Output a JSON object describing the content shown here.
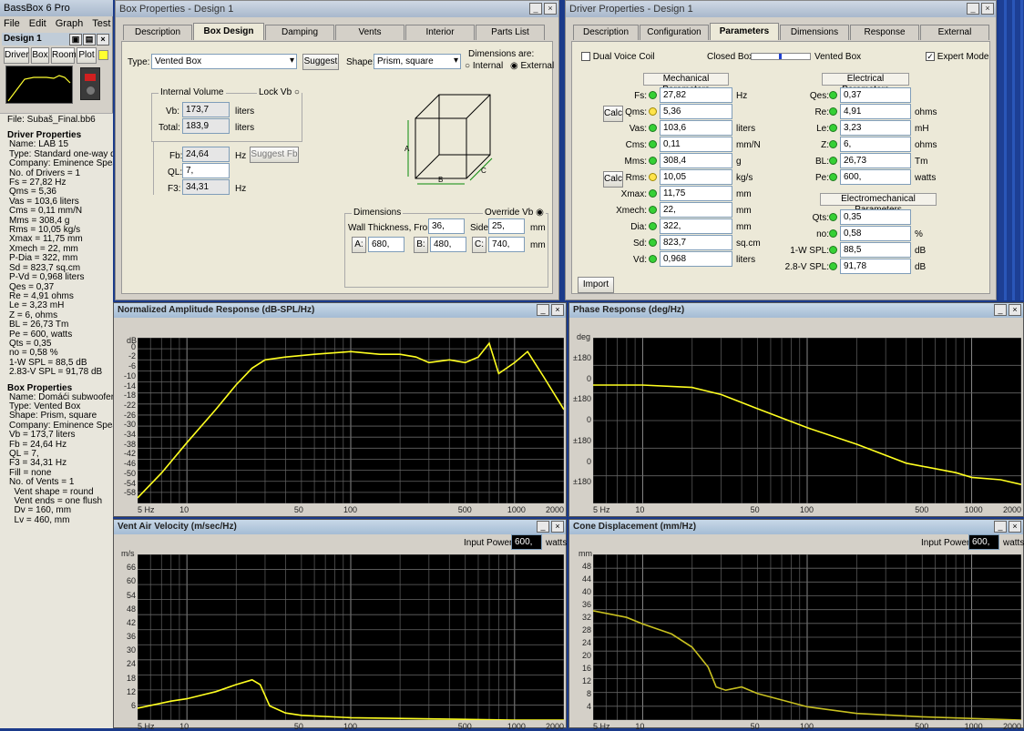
{
  "app": {
    "title": "BassBox 6 Pro",
    "menu": [
      "File",
      "Edit",
      "Graph",
      "Test"
    ],
    "design": "Design 1",
    "buttons": [
      "Driver",
      "Box",
      "Room",
      "Plot"
    ]
  },
  "sidebar": {
    "file": "File: Subaš_Final.bb6",
    "driver_heading": "Driver Properties",
    "driver_lines": [
      "Name: LAB 15",
      "Type: Standard one-way driver",
      "Company: Eminence Speaker",
      "No. of Drivers = 1",
      "Fs = 27,82 Hz",
      "Qms = 5,36",
      "Vas = 103,6 liters",
      "Cms = 0,11 mm/N",
      "Mms = 308,4 g",
      "Rms = 10,05 kg/s",
      "Xmax = 11,75 mm",
      "Xmech = 22, mm",
      "P-Dia = 322, mm",
      "Sd = 823,7 sq.cm",
      "P-Vd = 0,968 liters",
      "Qes = 0,37",
      "Re = 4,91 ohms",
      "Le = 3,23 mH",
      "Z = 6, ohms",
      "BL = 26,73 Tm",
      "Pe = 600, watts",
      "Qts = 0,35",
      "no = 0,58 %",
      "1-W SPL = 88,5 dB",
      "2.83-V SPL = 91,78 dB"
    ],
    "box_heading": "Box Properties",
    "box_lines": [
      "Name: Domáći subwoofer",
      "Type: Vented Box",
      "Shape: Prism, square",
      "Company: Eminence Speaker",
      "Vb = 173,7 liters",
      "Fb = 24,64 Hz",
      "QL = 7,",
      "F3 = 34,31 Hz",
      "Fill = none",
      "No. of Vents = 1",
      "  Vent shape = round",
      "  Vent ends = one flush",
      "  Dv = 160, mm",
      "  Lv = 460, mm"
    ]
  },
  "boxwin": {
    "title": "Box Properties - Design 1",
    "tabs": [
      "Description",
      "Box Design",
      "Damping",
      "Vents",
      "Interior",
      "Parts List"
    ],
    "type_label": "Type:",
    "type_value": "Vented Box",
    "suggest": "Suggest",
    "shape_label": "Shape:",
    "shape_value": "Prism, square",
    "dims_are": "Dimensions are:",
    "internal": "Internal",
    "external": "External",
    "iv_group": "Internal Volume",
    "lockvb": "Lock Vb",
    "vb_label": "Vb:",
    "vb_value": "173,7",
    "total_label": "Total:",
    "total_value": "183,9",
    "liters": "liters",
    "fb_label": "Fb:",
    "fb_value": "24,64",
    "hz": "Hz",
    "suggest_fb": "Suggest Fb",
    "ql_label": "QL:",
    "ql_value": "7,",
    "f3_label": "F3:",
    "f3_value": "34,31",
    "dims_group": "Dimensions",
    "override": "Override Vb",
    "wall_label": "Wall Thickness, Front:",
    "front": "36,",
    "side_label": "Side:",
    "side": "25,",
    "mm": "mm",
    "a_label": "A:",
    "a": "680,",
    "b_label": "B:",
    "b": "480,",
    "c_label": "C:",
    "c": "740,",
    "cube_a": "A",
    "cube_b": "B",
    "cube_c": "C"
  },
  "drvwin": {
    "title": "Driver Properties - Design 1",
    "tabs": [
      "Description",
      "Configuration",
      "Parameters",
      "Dimensions",
      "Response",
      "External"
    ],
    "dual": "Dual Voice Coil",
    "closed": "Closed Box",
    "vented": "Vented Box",
    "expert": "Expert Mode",
    "mech_hdr": "Mechanical Parameters",
    "elec_hdr": "Electrical Parameters",
    "em_hdr": "Electromechanical Parameters",
    "calc": "Calc",
    "import": "Import",
    "mech": [
      {
        "l": "Fs:",
        "v": "27,82",
        "u": "Hz",
        "d": "g"
      },
      {
        "l": "Qms:",
        "v": "5,36",
        "u": "",
        "d": "y"
      },
      {
        "l": "Vas:",
        "v": "103,6",
        "u": "liters",
        "d": "g"
      },
      {
        "l": "Cms:",
        "v": "0,11",
        "u": "mm/N",
        "d": "g"
      },
      {
        "l": "Mms:",
        "v": "308,4",
        "u": "g",
        "d": "g"
      },
      {
        "l": "Rms:",
        "v": "10,05",
        "u": "kg/s",
        "d": "y"
      },
      {
        "l": "Xmax:",
        "v": "11,75",
        "u": "mm",
        "d": "g"
      },
      {
        "l": "Xmech:",
        "v": "22,",
        "u": "mm",
        "d": "g"
      },
      {
        "l": "Dia:",
        "v": "322,",
        "u": "mm",
        "d": "g"
      },
      {
        "l": "Sd:",
        "v": "823,7",
        "u": "sq.cm",
        "d": "g"
      },
      {
        "l": "Vd:",
        "v": "0,968",
        "u": "liters",
        "d": "g"
      }
    ],
    "elec": [
      {
        "l": "Qes:",
        "v": "0,37",
        "u": ""
      },
      {
        "l": "Re:",
        "v": "4,91",
        "u": "ohms"
      },
      {
        "l": "Le:",
        "v": "3,23",
        "u": "mH"
      },
      {
        "l": "Z:",
        "v": "6,",
        "u": "ohms"
      },
      {
        "l": "BL:",
        "v": "26,73",
        "u": "Tm"
      },
      {
        "l": "Pe:",
        "v": "600,",
        "u": "watts"
      }
    ],
    "em": [
      {
        "l": "Qts:",
        "v": "0,35",
        "u": ""
      },
      {
        "l": "no:",
        "v": "0,58",
        "u": "%"
      },
      {
        "l": "1-W SPL:",
        "v": "88,5",
        "u": "dB"
      },
      {
        "l": "2.8-V SPL:",
        "v": "91,78",
        "u": "dB"
      }
    ]
  },
  "charts": {
    "amp": {
      "title": "Normalized Amplitude Response (dB-SPL/Hz)",
      "unit": "dB",
      "yticks": [
        "0",
        "-2",
        "-6",
        "-10",
        "-14",
        "-18",
        "-22",
        "-26",
        "-30",
        "-34",
        "-38",
        "-42",
        "-46",
        "-50",
        "-54",
        "-58"
      ]
    },
    "phase": {
      "title": "Phase Response (deg/Hz)",
      "unit": "deg",
      "yticks": [
        "±180",
        "0",
        "±180",
        "0",
        "±180",
        "0",
        "±180"
      ]
    },
    "vel": {
      "title": "Vent Air Velocity (m/sec/Hz)",
      "unit": "m/s",
      "yticks": [
        "66",
        "60",
        "54",
        "48",
        "42",
        "36",
        "30",
        "24",
        "18",
        "12",
        "6"
      ],
      "power_label": "Input Power:",
      "power": "600,",
      "watts": "watts"
    },
    "disp": {
      "title": "Cone Displacement (mm/Hz)",
      "unit": "mm",
      "yticks": [
        "48",
        "44",
        "40",
        "36",
        "32",
        "28",
        "24",
        "20",
        "16",
        "12",
        "8",
        "4"
      ],
      "power_label": "Input Power:",
      "power": "600,",
      "watts": "watts"
    },
    "xticks": [
      "5 Hz",
      "10",
      "50",
      "100",
      "500",
      "1000",
      "2000"
    ]
  },
  "chart_data": [
    {
      "type": "line",
      "title": "Normalized Amplitude Response (dB-SPL/Hz)",
      "ylabel": "dB",
      "xscale": "log",
      "xlim": [
        5,
        2000
      ],
      "ylim": [
        -60,
        0
      ],
      "x": [
        5,
        7,
        10,
        15,
        20,
        25,
        30,
        40,
        60,
        100,
        150,
        200,
        250,
        300,
        400,
        500,
        600,
        700,
        800,
        1000,
        1200,
        1500,
        2000
      ],
      "y": [
        -58,
        -49,
        -38,
        -26,
        -17,
        -11,
        -8,
        -7,
        -6,
        -5,
        -6,
        -6,
        -7,
        -9,
        -8,
        -9,
        -7,
        -2,
        -13,
        -9,
        -5,
        -14,
        -26
      ]
    },
    {
      "type": "line",
      "title": "Phase Response (deg/Hz)",
      "ylabel": "deg",
      "xscale": "log",
      "xlim": [
        5,
        2000
      ],
      "x": [
        5,
        10,
        20,
        30,
        50,
        100,
        200,
        400,
        800,
        1000,
        1500,
        2000
      ],
      "y": [
        -20,
        -20,
        -21,
        -24,
        -30,
        -38,
        -45,
        -53,
        -57,
        -59,
        -60,
        -62
      ]
    },
    {
      "type": "line",
      "title": "Vent Air Velocity (m/sec/Hz)",
      "ylabel": "m/s",
      "xscale": "log",
      "xlim": [
        5,
        2000
      ],
      "ylim": [
        0,
        70
      ],
      "x": [
        5,
        8,
        10,
        15,
        20,
        25,
        28,
        32,
        40,
        50,
        100,
        1000,
        2000
      ],
      "y": [
        5,
        8,
        9,
        12,
        15,
        17,
        15,
        6,
        3,
        2,
        1,
        0,
        0
      ]
    },
    {
      "type": "line",
      "title": "Cone Displacement (mm/Hz)",
      "ylabel": "mm",
      "xscale": "log",
      "xlim": [
        5,
        2000
      ],
      "ylim": [
        0,
        50
      ],
      "x": [
        5,
        8,
        10,
        15,
        20,
        25,
        28,
        32,
        40,
        50,
        100,
        200,
        500,
        2000
      ],
      "y": [
        33,
        31,
        29,
        26,
        22,
        16,
        10,
        9,
        10,
        8,
        4,
        2,
        1,
        0
      ]
    }
  ]
}
